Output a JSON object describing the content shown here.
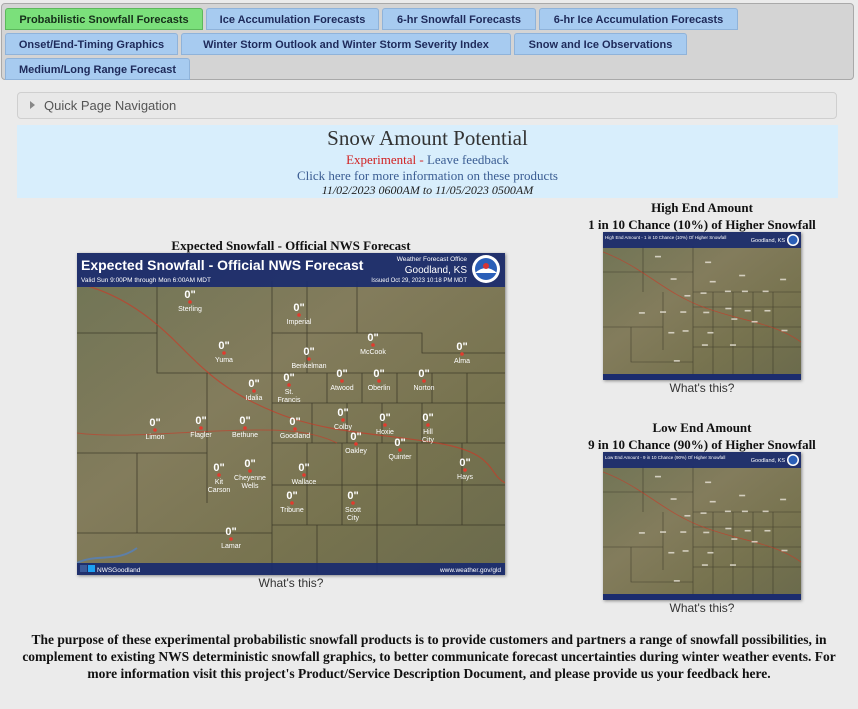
{
  "tabs": [
    {
      "label": "Probabilistic Snowfall Forecasts",
      "active": true
    },
    {
      "label": "Ice Accumulation Forecasts"
    },
    {
      "label": "6-hr Snowfall Forecasts"
    },
    {
      "label": "6-hr Ice Accumulation Forecasts"
    },
    {
      "label": "Onset/End-Timing Graphics"
    },
    {
      "label": "Winter Storm Outlook and Winter Storm Severity Index"
    },
    {
      "label": "Snow and Ice Observations"
    },
    {
      "label": "Medium/Long Range Forecast"
    }
  ],
  "quick_nav": {
    "label": "Quick Page Navigation"
  },
  "header": {
    "title": "Snow Amount Potential",
    "experimental": "Experimental",
    "separator": " - ",
    "feedback": "Leave feedback",
    "info_link": "Click here for more information on these products",
    "date_range": "11/02/2023 0600AM to 11/05/2023 0500AM"
  },
  "expected": {
    "caption": "Expected Snowfall - Official NWS Forecast",
    "map_title": "Expected Snowfall - Official NWS Forecast",
    "valid": "Valid Sun 9:00PM through Mon 6:00AM MDT",
    "office_line": "Weather Forecast Office",
    "office": "Goodland, KS",
    "issued": "Issued Oct 29, 2023 10:18 PM MDT",
    "social": "NWSGoodland",
    "website": "www.weather.gov/gld",
    "whats_this": "What's this?",
    "cities": [
      {
        "name": "Sterling",
        "value": "0\""
      },
      {
        "name": "Imperial",
        "value": "0\""
      },
      {
        "name": "Yuma",
        "value": "0\""
      },
      {
        "name": "McCook",
        "value": "0\""
      },
      {
        "name": "Benkelman",
        "value": "0\""
      },
      {
        "name": "Alma",
        "value": "0\""
      },
      {
        "name": "Idalia",
        "value": "0\""
      },
      {
        "name": "St. Francis",
        "value": "0\""
      },
      {
        "name": "Atwood",
        "value": "0\""
      },
      {
        "name": "Oberlin",
        "value": "0\""
      },
      {
        "name": "Norton",
        "value": "0\""
      },
      {
        "name": "Limon",
        "value": "0\""
      },
      {
        "name": "Flagler",
        "value": "0\""
      },
      {
        "name": "Bethune",
        "value": "0\""
      },
      {
        "name": "Goodland",
        "value": "0\""
      },
      {
        "name": "Colby",
        "value": "0\""
      },
      {
        "name": "Hoxie",
        "value": "0\""
      },
      {
        "name": "Hill City",
        "value": "0\""
      },
      {
        "name": "Oakley",
        "value": "0\""
      },
      {
        "name": "Quinter",
        "value": "0\""
      },
      {
        "name": "Kit Carson",
        "value": "0\""
      },
      {
        "name": "Cheyenne Wells",
        "value": "0\""
      },
      {
        "name": "Wallace",
        "value": "0\""
      },
      {
        "name": "Hays",
        "value": "0\""
      },
      {
        "name": "Tribune",
        "value": "0\""
      },
      {
        "name": "Scott City",
        "value": "0\""
      },
      {
        "name": "Lamar",
        "value": "0\""
      }
    ]
  },
  "high_end": {
    "caption_line1": "High End Amount",
    "caption_line2": "1 in 10 Chance (10%) of Higher Snowfall",
    "map_title": "High End Amount - 1 in 10 Chance (10%) Of Higher Snowfall",
    "office": "Goodland, KS",
    "whats_this": "What's this?"
  },
  "low_end": {
    "caption_line1": "Low End Amount",
    "caption_line2": "9 in 10 Chance (90%) of Higher Snowfall",
    "map_title": "Low End Amount - 9 in 10 Chance (90%) Of Higher Snowfall",
    "office": "Goodland, KS",
    "whats_this": "What's this?"
  },
  "footer": {
    "text_before": "The purpose of these experimental probabilistic snowfall products is to provide customers and partners a range of snowfall possibilities, in complement to existing NWS deterministic snowfall graphics, to better communicate forecast uncertainties during winter weather events. For more information visit this project's ",
    "doc_link": "Product/Service Description Document",
    "text_middle": ", and please provide us your feedback ",
    "here_link": "here",
    "text_end": "."
  }
}
